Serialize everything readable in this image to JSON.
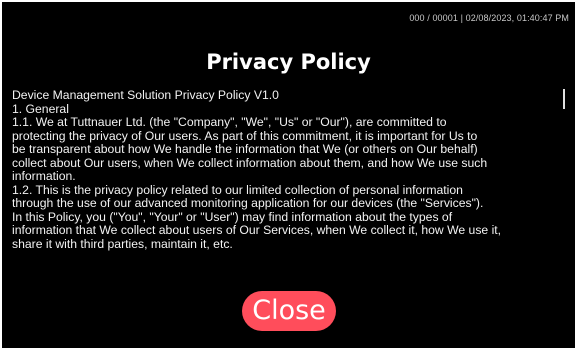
{
  "status_bar": {
    "text": "000 / 00001 | 02/08/2023, 01:40:47 PM"
  },
  "header": {
    "title": "Privacy Policy"
  },
  "policy": {
    "heading": "Device Management Solution Privacy Policy V1.0",
    "section_1": "1.     General",
    "lines": [
      "1.1.  We at Tuttnauer Ltd. (the \"Company\", \"We\", \"Us\" or \"Our\"), are committed to",
      "protecting the privacy of Our users. As part of this commitment, it is important for Us to",
      "be transparent about how We handle the information that We (or others on Our behalf)",
      "collect about Our users, when We collect information about them, and how We use such",
      "information.",
      "1.2.  This is the privacy policy related to our limited collection of personal information",
      "through the use of our advanced monitoring application for our devices (the \"Services\").",
      "In this Policy, you (\"You\", \"Your\" or \"User\") may find information about the types of",
      "information that We collect about users of Our Services, when We collect it, how We use it,",
      "share it with third parties, maintain it, etc."
    ]
  },
  "actions": {
    "close_label": "Close"
  },
  "colors": {
    "background": "#000000",
    "text": "#f2f2f2",
    "close_button": "#ff4d5b"
  }
}
